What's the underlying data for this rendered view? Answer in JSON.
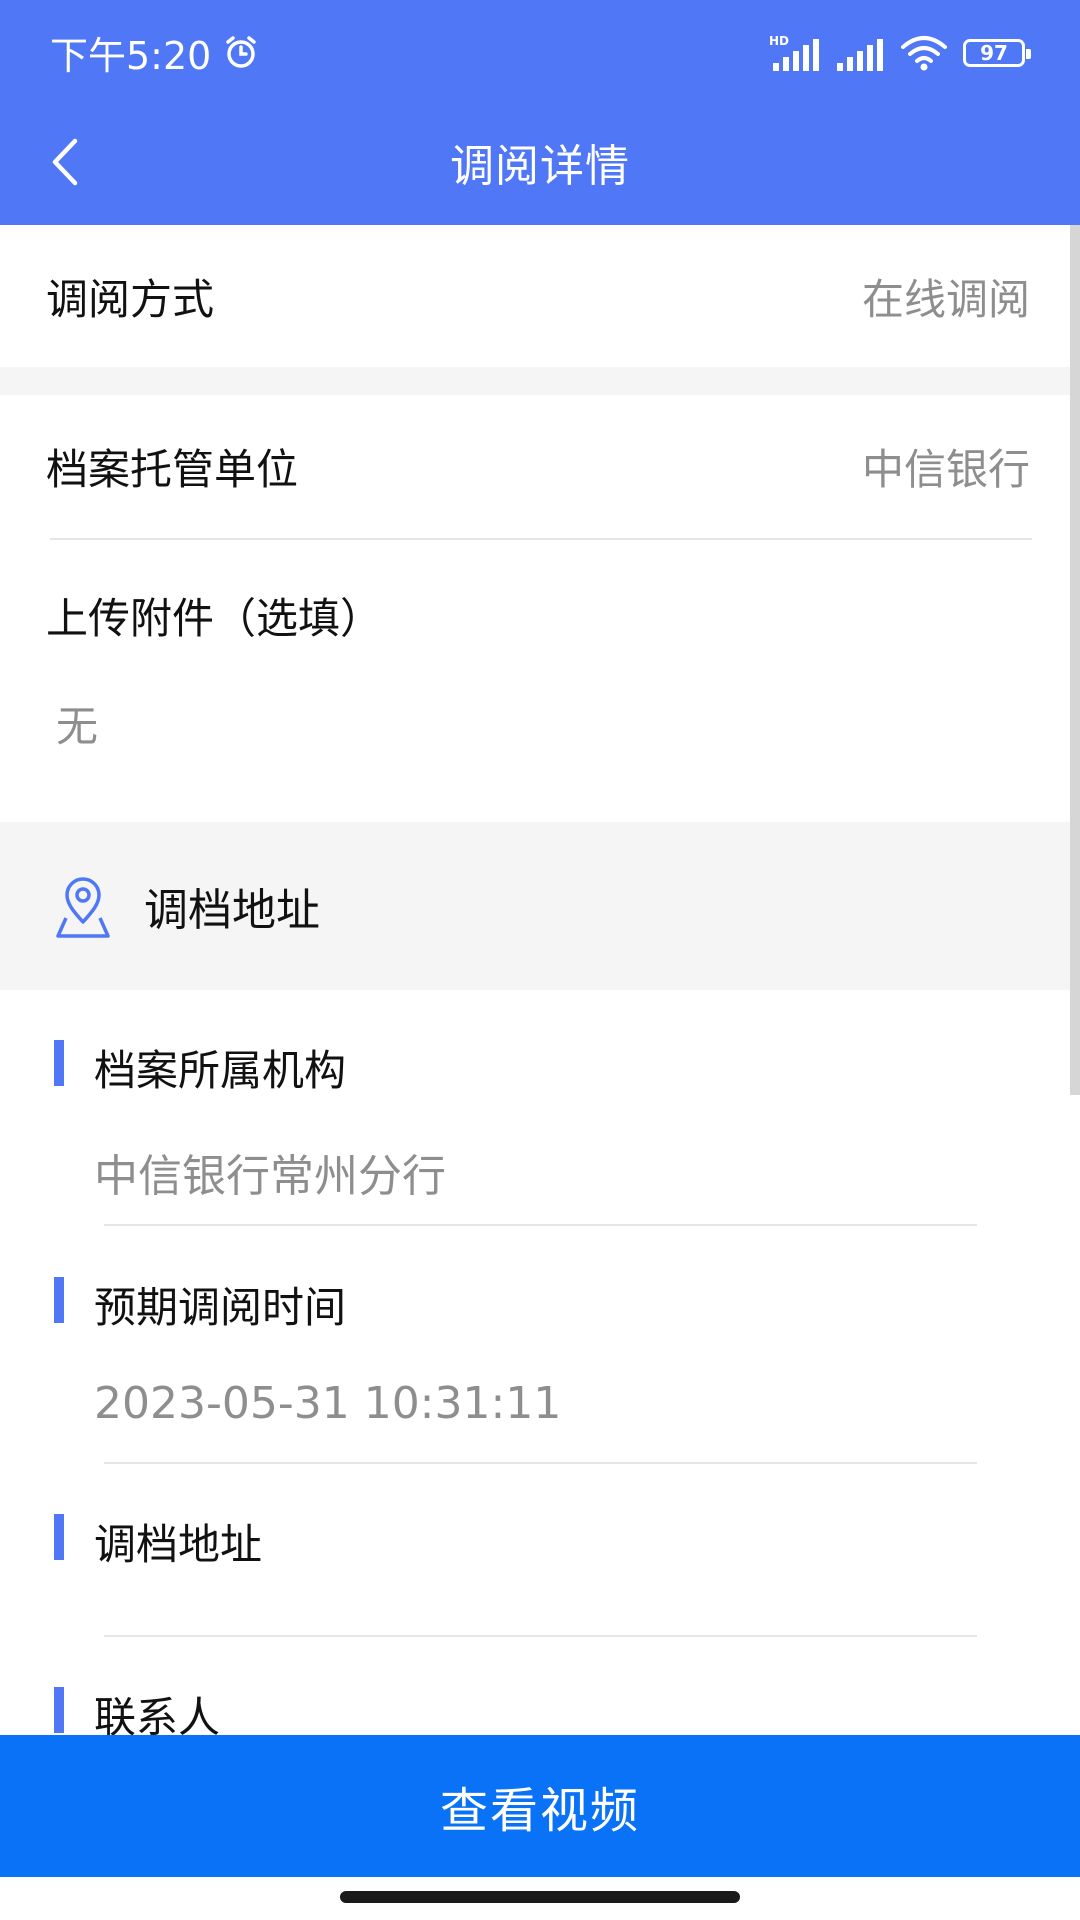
{
  "status_bar": {
    "time": "下午5:20",
    "battery": "97",
    "hd_label": "HD",
    "icons": [
      "alarm-icon",
      "signal-hd-icon",
      "signal-icon",
      "wifi-icon",
      "battery-icon"
    ]
  },
  "header": {
    "title": "调阅详情",
    "back_icon": "chevron-left-icon"
  },
  "info": {
    "method_label": "调阅方式",
    "method_value": "在线调阅",
    "custodian_label": "档案托管单位",
    "custodian_value": "中信银行",
    "attachment_label": "上传附件（选填）",
    "attachment_value": "无"
  },
  "address_section": {
    "title": "调档地址",
    "icon": "location-pin-icon",
    "fields": [
      {
        "label": "档案所属机构",
        "value": "中信银行常州分行"
      },
      {
        "label": "预期调阅时间",
        "value": "2023-05-31 10:31:11"
      },
      {
        "label": "调档地址",
        "value": ""
      },
      {
        "label": "联系人",
        "value": ""
      }
    ]
  },
  "action": {
    "view_video_label": "查看视频"
  },
  "colors": {
    "primary": "#4f77f6",
    "button": "#0a72f7",
    "muted_text": "#8e8e8e",
    "section_bg": "#f5f5f5"
  }
}
